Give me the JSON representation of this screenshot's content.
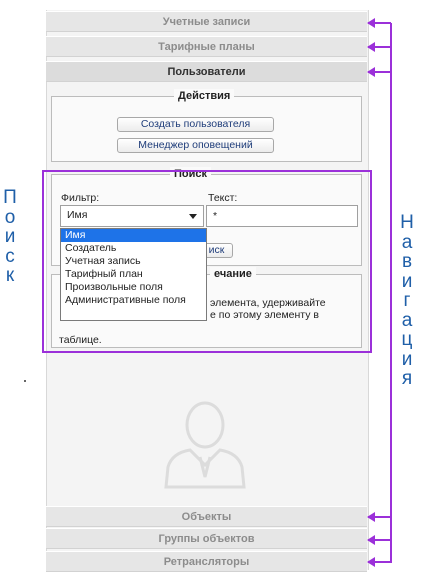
{
  "accordion": {
    "accounts": "Учетные записи",
    "tariff_plans": "Тарифные планы",
    "users": "Пользователи",
    "objects": "Объекты",
    "object_groups": "Группы объектов",
    "retranslators": "Ретрансляторы"
  },
  "actions": {
    "legend": "Действия",
    "create_user": "Создать пользователя",
    "notification_manager": "Менеджер оповещений"
  },
  "search": {
    "legend": "Поиск",
    "filter_label": "Фильтр:",
    "filter_value": "Имя",
    "text_label": "Текст:",
    "text_value": "*",
    "search_button_partial": "иск",
    "options": [
      "Имя",
      "Создатель",
      "Учетная запись",
      "Тарифный план",
      "Произвольные поля",
      "Административные поля"
    ]
  },
  "note": {
    "legend_partial": "ечание",
    "line1": "элемента, удерживайте",
    "line2": "е по этому элементу в",
    "line3": "таблице."
  },
  "annotations": {
    "search": [
      "П",
      "о",
      "и",
      "с",
      "к"
    ],
    "navigation": [
      "Н",
      "а",
      "в",
      "и",
      "г",
      "а",
      "ц",
      "и",
      "я"
    ],
    "search_color": "#1f5fa8",
    "navigation_color": "#1f5fa8",
    "bracket_color": "#9b30d9"
  },
  "colors": {
    "selected_option": "#1e73e8",
    "link_text": "#1f3d7a"
  }
}
